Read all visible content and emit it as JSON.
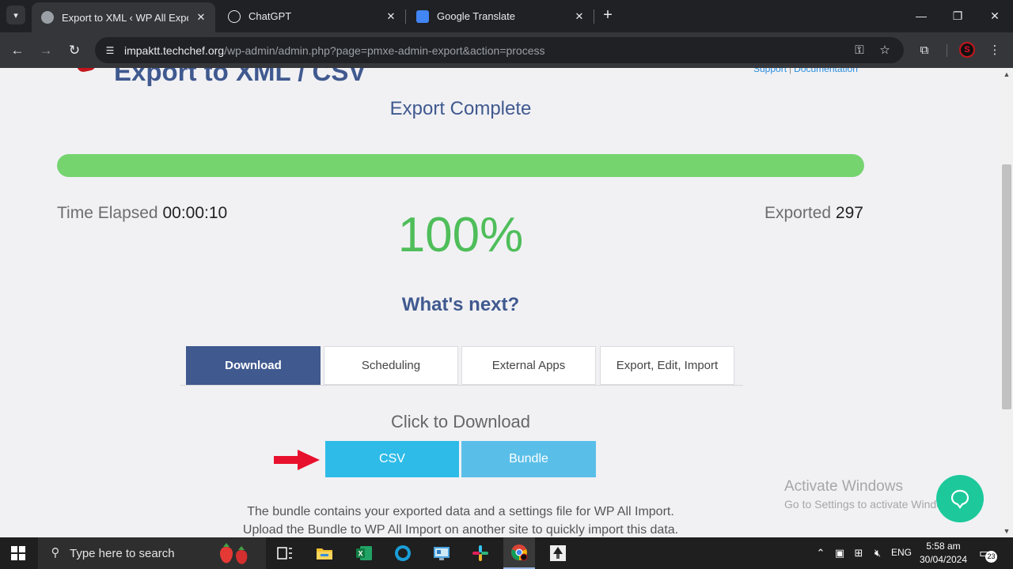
{
  "browser": {
    "tabs": [
      {
        "title": "Export to XML ‹ WP All Export ‹",
        "active": true
      },
      {
        "title": "ChatGPT",
        "active": false
      },
      {
        "title": "Google Translate",
        "active": false
      }
    ],
    "url_host": "impaktt.techchef.org",
    "url_path": "/wp-admin/admin.php?page=pmxe-admin-export&action=process"
  },
  "page": {
    "heading": "Export to XML / CSV",
    "top_link_support": "Support",
    "top_link_separator": "|",
    "top_link_docs": "Documentation",
    "status_title": "Export Complete",
    "progress_percent": 100,
    "time_elapsed_label": "Time Elapsed",
    "time_elapsed_value": "00:00:10",
    "percent_text": "100%",
    "exported_label": "Exported",
    "exported_value": "297",
    "whats_next": "What's next?",
    "option_tabs": [
      "Download",
      "Scheduling",
      "External Apps",
      "Export, Edit, Import"
    ],
    "click_to_download": "Click to Download",
    "csv_button": "CSV",
    "bundle_button": "Bundle",
    "bundle_desc_line1": "The bundle contains your exported data and a settings file for WP All Import.",
    "bundle_desc_line2": "Upload the Bundle to WP All Import on another site to quickly import this data."
  },
  "watermark": {
    "line1": "Activate Windows",
    "line2": "Go to Settings to activate Windows."
  },
  "taskbar": {
    "search_placeholder": "Type here to search",
    "language": "ENG",
    "time": "5:58 am",
    "date": "30/04/2024",
    "notification_count": "23"
  },
  "colors": {
    "brand_blue": "#40598f",
    "progress_green": "#76d46f",
    "percent_green": "#4fbe5a",
    "download_cyan": "#2ebbe8",
    "help_bubble": "#1dc99b",
    "arrow_red": "#e8112d"
  },
  "icons": {
    "tab_search": "chevron-down-icon",
    "back": "arrow-left-icon",
    "forward": "arrow-right-icon",
    "reload": "reload-icon",
    "site_info": "tune-icon",
    "password": "key-icon",
    "bookmark": "star-icon",
    "extensions": "puzzle-icon",
    "menu": "kebab-icon",
    "help": "chat-bubble-icon"
  }
}
